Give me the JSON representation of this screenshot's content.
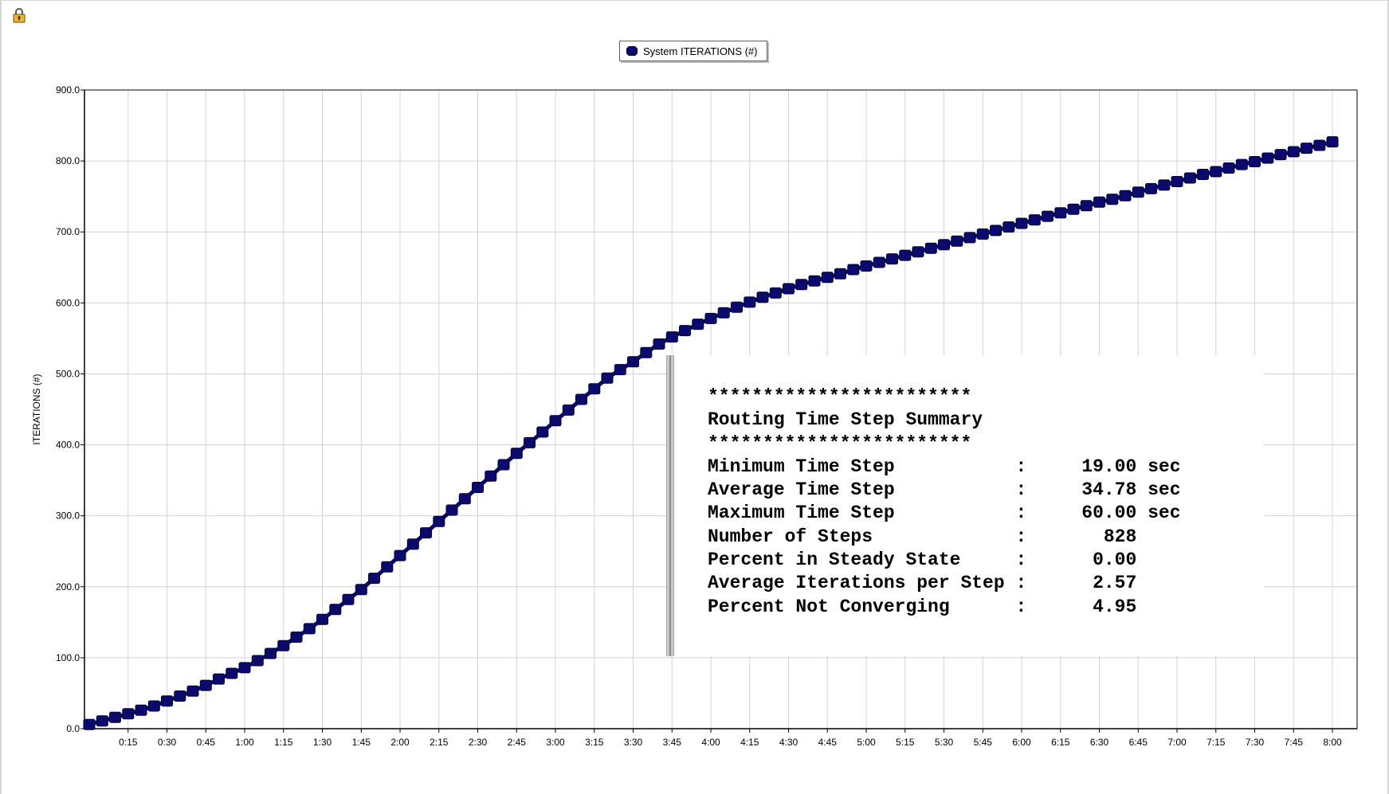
{
  "window": {
    "lock_icon": "lock-icon"
  },
  "legend": {
    "label": "System ITERATIONS (#)",
    "color": "#0a0a6e"
  },
  "chart_data": {
    "type": "line",
    "title": "",
    "xlabel": "",
    "ylabel": "ITERATIONS (#)",
    "ylim": [
      0,
      900
    ],
    "yticks": [
      "0.0",
      "100.0",
      "200.0",
      "300.0",
      "400.0",
      "500.0",
      "600.0",
      "700.0",
      "800.0",
      "900.0"
    ],
    "xlim_minutes": [
      0,
      480
    ],
    "xticks": [
      "0:15",
      "0:30",
      "0:45",
      "1:00",
      "1:15",
      "1:30",
      "1:45",
      "2:00",
      "2:15",
      "2:30",
      "2:45",
      "3:00",
      "3:15",
      "3:30",
      "3:45",
      "4:00",
      "4:15",
      "4:30",
      "4:45",
      "5:00",
      "5:15",
      "5:30",
      "5:45",
      "6:00",
      "6:15",
      "6:30",
      "6:45",
      "7:00",
      "7:15",
      "7:30",
      "7:45",
      "8:00"
    ],
    "grid": true,
    "legend_position": "top-center",
    "series": [
      {
        "name": "System ITERATIONS (#)",
        "color": "#0a0a6e",
        "x": [
          "0:00",
          "0:05",
          "0:10",
          "0:15",
          "0:20",
          "0:25",
          "0:30",
          "0:35",
          "0:40",
          "0:45",
          "0:50",
          "0:55",
          "1:00",
          "1:05",
          "1:10",
          "1:15",
          "1:20",
          "1:25",
          "1:30",
          "1:35",
          "1:40",
          "1:45",
          "1:50",
          "1:55",
          "2:00",
          "2:05",
          "2:10",
          "2:15",
          "2:20",
          "2:25",
          "2:30",
          "2:35",
          "2:40",
          "2:45",
          "2:50",
          "2:55",
          "3:00",
          "3:05",
          "3:10",
          "3:15",
          "3:20",
          "3:25",
          "3:30",
          "3:35",
          "3:40",
          "3:45",
          "3:50",
          "3:55",
          "4:00",
          "4:05",
          "4:10",
          "4:15",
          "4:20",
          "4:25",
          "4:30",
          "4:35",
          "4:40",
          "4:45",
          "4:50",
          "4:55",
          "5:00",
          "5:05",
          "5:10",
          "5:15",
          "5:20",
          "5:25",
          "5:30",
          "5:35",
          "5:40",
          "5:45",
          "5:50",
          "5:55",
          "6:00",
          "6:05",
          "6:10",
          "6:15",
          "6:20",
          "6:25",
          "6:30",
          "6:35",
          "6:40",
          "6:45",
          "6:50",
          "6:55",
          "7:00",
          "7:05",
          "7:10",
          "7:15",
          "7:20",
          "7:25",
          "7:30",
          "7:35",
          "7:40",
          "7:45",
          "7:50",
          "7:55",
          "8:00"
        ],
        "values": [
          6,
          11,
          16,
          21,
          26,
          32,
          39,
          46,
          53,
          61,
          70,
          78,
          86,
          96,
          106,
          117,
          129,
          141,
          154,
          168,
          182,
          196,
          212,
          228,
          244,
          260,
          276,
          292,
          308,
          324,
          340,
          356,
          372,
          388,
          403,
          418,
          434,
          449,
          464,
          479,
          494,
          506,
          517,
          530,
          542,
          552,
          561,
          570,
          578,
          586,
          594,
          601,
          608,
          614,
          620,
          626,
          631,
          636,
          641,
          647,
          652,
          657,
          662,
          667,
          672,
          677,
          682,
          687,
          692,
          697,
          702,
          707,
          712,
          717,
          722,
          727,
          732,
          737,
          742,
          746,
          751,
          756,
          761,
          766,
          771,
          776,
          781,
          785,
          790,
          795,
          799,
          804,
          809,
          813,
          818,
          822,
          827
        ]
      }
    ]
  },
  "summary": {
    "stars_top": "************************",
    "title": "Routing Time Step Summary",
    "stars_bottom": "************************",
    "rows": [
      {
        "label": "Minimum Time Step",
        "value": "19.00",
        "unit": "sec"
      },
      {
        "label": "Average Time Step",
        "value": "34.78",
        "unit": "sec"
      },
      {
        "label": "Maximum Time Step",
        "value": "60.00",
        "unit": "sec"
      },
      {
        "label": "Number of Steps",
        "value": "828",
        "unit": ""
      },
      {
        "label": "Percent in Steady State",
        "value": "0.00",
        "unit": ""
      },
      {
        "label": "Average Iterations per Step",
        "value": "2.57",
        "unit": ""
      },
      {
        "label": "Percent Not Converging",
        "value": "4.95",
        "unit": ""
      }
    ]
  }
}
